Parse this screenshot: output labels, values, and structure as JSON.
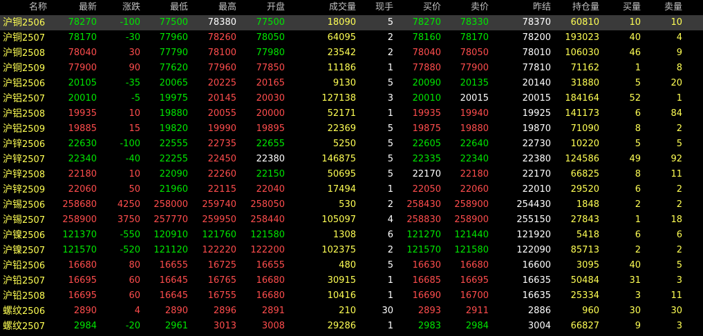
{
  "headers": {
    "name": "名称",
    "last": "最新",
    "change": "涨跌",
    "low": "最低",
    "high": "最高",
    "open": "开盘",
    "volume": "成交量",
    "current_hand": "现手",
    "bid": "买价",
    "ask": "卖价",
    "prev_settle": "昨结",
    "open_interest": "持仓量",
    "bid_qty": "买量",
    "ask_qty": "卖量"
  },
  "colors": {
    "background": "#000000",
    "selected_row": "#3a3a3a",
    "up": "#ff4d4d",
    "down": "#00e600",
    "flat": "#ffffff",
    "name": "#ffff54",
    "volume": "#ffff54",
    "header": "#c0c0c0"
  },
  "rows": [
    {
      "name": "沪铜",
      "code": "2506",
      "last": "78270",
      "change": "-100",
      "low": "77500",
      "high": "78380",
      "open": "77500",
      "volume": "18090",
      "curr": "5",
      "bid": "78270",
      "ask": "78330",
      "prev": "78370",
      "oi": "60810",
      "bidq": "10",
      "askq": "10",
      "selected": true,
      "c_last": "down",
      "c_chg": "down",
      "c_low": "down",
      "c_high": "flat",
      "c_open": "down",
      "c_bid": "down",
      "c_ask": "down"
    },
    {
      "name": "沪铜",
      "code": "2507",
      "last": "78170",
      "change": "-30",
      "low": "77960",
      "high": "78260",
      "open": "78050",
      "volume": "64095",
      "curr": "2",
      "bid": "78160",
      "ask": "78170",
      "prev": "78200",
      "oi": "193023",
      "bidq": "40",
      "askq": "4",
      "c_last": "down",
      "c_chg": "down",
      "c_low": "down",
      "c_high": "up",
      "c_open": "down",
      "c_bid": "down",
      "c_ask": "down"
    },
    {
      "name": "沪铜",
      "code": "2508",
      "last": "78040",
      "change": "30",
      "low": "77790",
      "high": "78100",
      "open": "77980",
      "volume": "23542",
      "curr": "2",
      "bid": "78040",
      "ask": "78050",
      "prev": "78010",
      "oi": "106030",
      "bidq": "46",
      "askq": "9",
      "c_last": "up",
      "c_chg": "up",
      "c_low": "down",
      "c_high": "up",
      "c_open": "down",
      "c_bid": "up",
      "c_ask": "up"
    },
    {
      "name": "沪铜",
      "code": "2509",
      "last": "77900",
      "change": "90",
      "low": "77620",
      "high": "77960",
      "open": "77850",
      "volume": "11186",
      "curr": "1",
      "bid": "77880",
      "ask": "77900",
      "prev": "77810",
      "oi": "71162",
      "bidq": "1",
      "askq": "8",
      "c_last": "up",
      "c_chg": "up",
      "c_low": "down",
      "c_high": "up",
      "c_open": "up",
      "c_bid": "up",
      "c_ask": "up"
    },
    {
      "name": "沪铝",
      "code": "2506",
      "last": "20105",
      "change": "-35",
      "low": "20065",
      "high": "20225",
      "open": "20165",
      "volume": "9130",
      "curr": "5",
      "bid": "20090",
      "ask": "20135",
      "prev": "20140",
      "oi": "31880",
      "bidq": "5",
      "askq": "20",
      "c_last": "down",
      "c_chg": "down",
      "c_low": "down",
      "c_high": "up",
      "c_open": "up",
      "c_bid": "down",
      "c_ask": "down"
    },
    {
      "name": "沪铝",
      "code": "2507",
      "last": "20010",
      "change": "-5",
      "low": "19975",
      "high": "20145",
      "open": "20030",
      "volume": "127138",
      "curr": "3",
      "bid": "20010",
      "ask": "20015",
      "prev": "20015",
      "oi": "184164",
      "bidq": "52",
      "askq": "1",
      "c_last": "down",
      "c_chg": "down",
      "c_low": "down",
      "c_high": "up",
      "c_open": "up",
      "c_bid": "down",
      "c_ask": "flat"
    },
    {
      "name": "沪铝",
      "code": "2508",
      "last": "19935",
      "change": "10",
      "low": "19880",
      "high": "20055",
      "open": "20000",
      "volume": "52171",
      "curr": "1",
      "bid": "19935",
      "ask": "19940",
      "prev": "19925",
      "oi": "141173",
      "bidq": "6",
      "askq": "84",
      "c_last": "up",
      "c_chg": "up",
      "c_low": "down",
      "c_high": "up",
      "c_open": "up",
      "c_bid": "up",
      "c_ask": "up"
    },
    {
      "name": "沪铝",
      "code": "2509",
      "last": "19885",
      "change": "15",
      "low": "19820",
      "high": "19990",
      "open": "19895",
      "volume": "22369",
      "curr": "5",
      "bid": "19875",
      "ask": "19880",
      "prev": "19870",
      "oi": "71090",
      "bidq": "8",
      "askq": "2",
      "c_last": "up",
      "c_chg": "up",
      "c_low": "down",
      "c_high": "up",
      "c_open": "up",
      "c_bid": "up",
      "c_ask": "up"
    },
    {
      "name": "沪锌",
      "code": "2506",
      "last": "22630",
      "change": "-100",
      "low": "22555",
      "high": "22735",
      "open": "22655",
      "volume": "5250",
      "curr": "5",
      "bid": "22605",
      "ask": "22640",
      "prev": "22730",
      "oi": "10220",
      "bidq": "5",
      "askq": "5",
      "c_last": "down",
      "c_chg": "down",
      "c_low": "down",
      "c_high": "up",
      "c_open": "down",
      "c_bid": "down",
      "c_ask": "down"
    },
    {
      "name": "沪锌",
      "code": "2507",
      "last": "22340",
      "change": "-40",
      "low": "22255",
      "high": "22450",
      "open": "22380",
      "volume": "146875",
      "curr": "5",
      "bid": "22335",
      "ask": "22340",
      "prev": "22380",
      "oi": "124586",
      "bidq": "49",
      "askq": "92",
      "c_last": "down",
      "c_chg": "down",
      "c_low": "down",
      "c_high": "up",
      "c_open": "flat",
      "c_bid": "down",
      "c_ask": "down"
    },
    {
      "name": "沪锌",
      "code": "2508",
      "last": "22180",
      "change": "10",
      "low": "22090",
      "high": "22260",
      "open": "22150",
      "volume": "50695",
      "curr": "5",
      "bid": "22170",
      "ask": "22180",
      "prev": "22170",
      "oi": "66825",
      "bidq": "8",
      "askq": "11",
      "c_last": "up",
      "c_chg": "up",
      "c_low": "down",
      "c_high": "up",
      "c_open": "down",
      "c_bid": "flat",
      "c_ask": "up"
    },
    {
      "name": "沪锌",
      "code": "2509",
      "last": "22060",
      "change": "50",
      "low": "21960",
      "high": "22115",
      "open": "22040",
      "volume": "17494",
      "curr": "1",
      "bid": "22050",
      "ask": "22060",
      "prev": "22010",
      "oi": "29520",
      "bidq": "6",
      "askq": "2",
      "c_last": "up",
      "c_chg": "up",
      "c_low": "down",
      "c_high": "up",
      "c_open": "up",
      "c_bid": "up",
      "c_ask": "up"
    },
    {
      "name": "沪锡",
      "code": "2506",
      "last": "258680",
      "change": "4250",
      "low": "258000",
      "high": "259740",
      "open": "258050",
      "volume": "530",
      "curr": "2",
      "bid": "258430",
      "ask": "258900",
      "prev": "254430",
      "oi": "1848",
      "bidq": "2",
      "askq": "2",
      "c_last": "up",
      "c_chg": "up",
      "c_low": "up",
      "c_high": "up",
      "c_open": "up",
      "c_bid": "up",
      "c_ask": "up"
    },
    {
      "name": "沪锡",
      "code": "2507",
      "last": "258900",
      "change": "3750",
      "low": "257770",
      "high": "259950",
      "open": "258440",
      "volume": "105097",
      "curr": "4",
      "bid": "258830",
      "ask": "258900",
      "prev": "255150",
      "oi": "27843",
      "bidq": "1",
      "askq": "18",
      "c_last": "up",
      "c_chg": "up",
      "c_low": "up",
      "c_high": "up",
      "c_open": "up",
      "c_bid": "up",
      "c_ask": "up"
    },
    {
      "name": "沪镍",
      "code": "2506",
      "last": "121370",
      "change": "-550",
      "low": "120910",
      "high": "121760",
      "open": "121580",
      "volume": "1308",
      "curr": "6",
      "bid": "121270",
      "ask": "121440",
      "prev": "121920",
      "oi": "5418",
      "bidq": "6",
      "askq": "6",
      "c_last": "down",
      "c_chg": "down",
      "c_low": "down",
      "c_high": "down",
      "c_open": "down",
      "c_bid": "down",
      "c_ask": "down"
    },
    {
      "name": "沪镍",
      "code": "2507",
      "last": "121570",
      "change": "-520",
      "low": "121120",
      "high": "122220",
      "open": "122200",
      "volume": "102375",
      "curr": "2",
      "bid": "121570",
      "ask": "121580",
      "prev": "122090",
      "oi": "85713",
      "bidq": "2",
      "askq": "2",
      "c_last": "down",
      "c_chg": "down",
      "c_low": "down",
      "c_high": "up",
      "c_open": "up",
      "c_bid": "down",
      "c_ask": "down"
    },
    {
      "name": "沪铅",
      "code": "2506",
      "last": "16680",
      "change": "80",
      "low": "16655",
      "high": "16725",
      "open": "16655",
      "volume": "480",
      "curr": "5",
      "bid": "16630",
      "ask": "16680",
      "prev": "16600",
      "oi": "3095",
      "bidq": "40",
      "askq": "5",
      "c_last": "up",
      "c_chg": "up",
      "c_low": "up",
      "c_high": "up",
      "c_open": "up",
      "c_bid": "up",
      "c_ask": "up"
    },
    {
      "name": "沪铅",
      "code": "2507",
      "last": "16695",
      "change": "60",
      "low": "16645",
      "high": "16765",
      "open": "16680",
      "volume": "30915",
      "curr": "1",
      "bid": "16685",
      "ask": "16695",
      "prev": "16635",
      "oi": "50484",
      "bidq": "31",
      "askq": "3",
      "c_last": "up",
      "c_chg": "up",
      "c_low": "up",
      "c_high": "up",
      "c_open": "up",
      "c_bid": "up",
      "c_ask": "up"
    },
    {
      "name": "沪铅",
      "code": "2508",
      "last": "16695",
      "change": "60",
      "low": "16645",
      "high": "16755",
      "open": "16680",
      "volume": "10416",
      "curr": "1",
      "bid": "16690",
      "ask": "16700",
      "prev": "16635",
      "oi": "25334",
      "bidq": "3",
      "askq": "11",
      "c_last": "up",
      "c_chg": "up",
      "c_low": "up",
      "c_high": "up",
      "c_open": "up",
      "c_bid": "up",
      "c_ask": "up"
    },
    {
      "name": "螺纹",
      "code": "2506",
      "last": "2890",
      "change": "4",
      "low": "2890",
      "high": "2896",
      "open": "2891",
      "volume": "210",
      "curr": "30",
      "bid": "2893",
      "ask": "2911",
      "prev": "2886",
      "oi": "960",
      "bidq": "30",
      "askq": "30",
      "c_last": "up",
      "c_chg": "up",
      "c_low": "up",
      "c_high": "up",
      "c_open": "up",
      "c_bid": "up",
      "c_ask": "up"
    },
    {
      "name": "螺纹",
      "code": "2507",
      "last": "2984",
      "change": "-20",
      "low": "2961",
      "high": "3013",
      "open": "3008",
      "volume": "29286",
      "curr": "1",
      "bid": "2983",
      "ask": "2984",
      "prev": "3004",
      "oi": "66827",
      "bidq": "9",
      "askq": "3",
      "c_last": "down",
      "c_chg": "down",
      "c_low": "down",
      "c_high": "up",
      "c_open": "up",
      "c_bid": "down",
      "c_ask": "down"
    }
  ]
}
